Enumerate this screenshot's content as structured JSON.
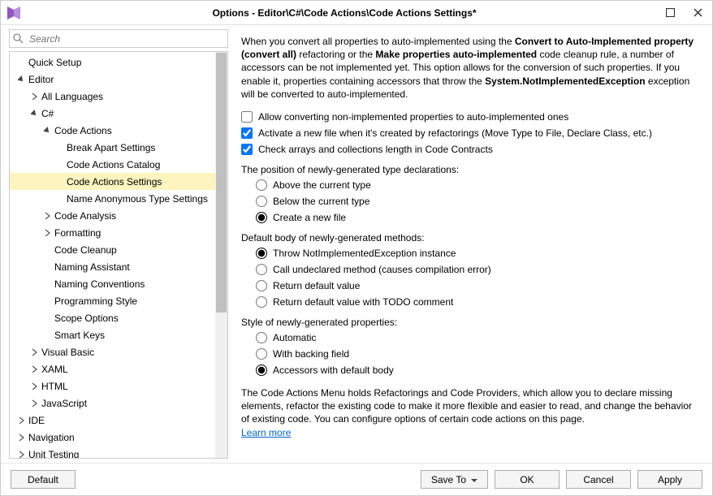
{
  "window": {
    "title": "Options - Editor\\C#\\Code Actions\\Code Actions Settings*"
  },
  "search": {
    "placeholder": "Search"
  },
  "tree": {
    "quick_setup": "Quick Setup",
    "editor": "Editor",
    "all_languages": "All Languages",
    "csharp": "C#",
    "code_actions": "Code Actions",
    "break_apart": "Break Apart Settings",
    "catalog": "Code Actions Catalog",
    "settings": "Code Actions Settings",
    "name_anon": "Name Anonymous Type Settings",
    "code_analysis": "Code Analysis",
    "formatting": "Formatting",
    "code_cleanup": "Code Cleanup",
    "naming_assistant": "Naming Assistant",
    "naming_conventions": "Naming Conventions",
    "programming_style": "Programming Style",
    "scope_options": "Scope Options",
    "smart_keys": "Smart Keys",
    "visual_basic": "Visual Basic",
    "xaml": "XAML",
    "html": "HTML",
    "javascript": "JavaScript",
    "ide": "IDE",
    "navigation": "Navigation",
    "unit_testing": "Unit Testing"
  },
  "main": {
    "intro1": "When you convert all properties to auto-implemented using the ",
    "intro1b": "Convert to Auto-Implemented property (convert all)",
    "intro2": " refactoring or the ",
    "intro2b": "Make properties auto-implemented",
    "intro3": " code cleanup rule, a number of accessors can be not implemented yet. This option allows for the conversion of such properties. If you enable it, properties containing accessors that throw the ",
    "intro3b": "System.NotImplementedException",
    "intro4": " exception will be converted to auto-implemented.",
    "chk_allow": "Allow converting non-implemented properties to auto-implemented ones",
    "chk_activate": "Activate a new file when it's created by refactorings (Move Type to File, Declare Class, etc.)",
    "chk_check": "Check arrays and collections length in Code Contracts",
    "grp_position": "The position of newly-generated type declarations:",
    "pos_above": "Above the current type",
    "pos_below": "Below the current type",
    "pos_new": "Create a new file",
    "grp_body": "Default body of newly-generated methods:",
    "body_throw": "Throw NotImplementedException instance",
    "body_call": "Call undeclared method (causes compilation error)",
    "body_return": "Return default value",
    "body_todo": "Return default value with TODO comment",
    "grp_style": "Style of newly-generated properties:",
    "style_auto": "Automatic",
    "style_backing": "With backing field",
    "style_accessors": "Accessors with default body",
    "footer": "The Code Actions Menu holds Refactorings and Code Providers, which allow you to declare missing elements, refactor the existing code to make it more flexible and easier to read, and change the behavior of existing code. You can configure options of certain code actions on this page.",
    "learn_more": "Learn more"
  },
  "buttons": {
    "default": "Default",
    "save_to": "Save To",
    "ok": "OK",
    "cancel": "Cancel",
    "apply": "Apply"
  }
}
